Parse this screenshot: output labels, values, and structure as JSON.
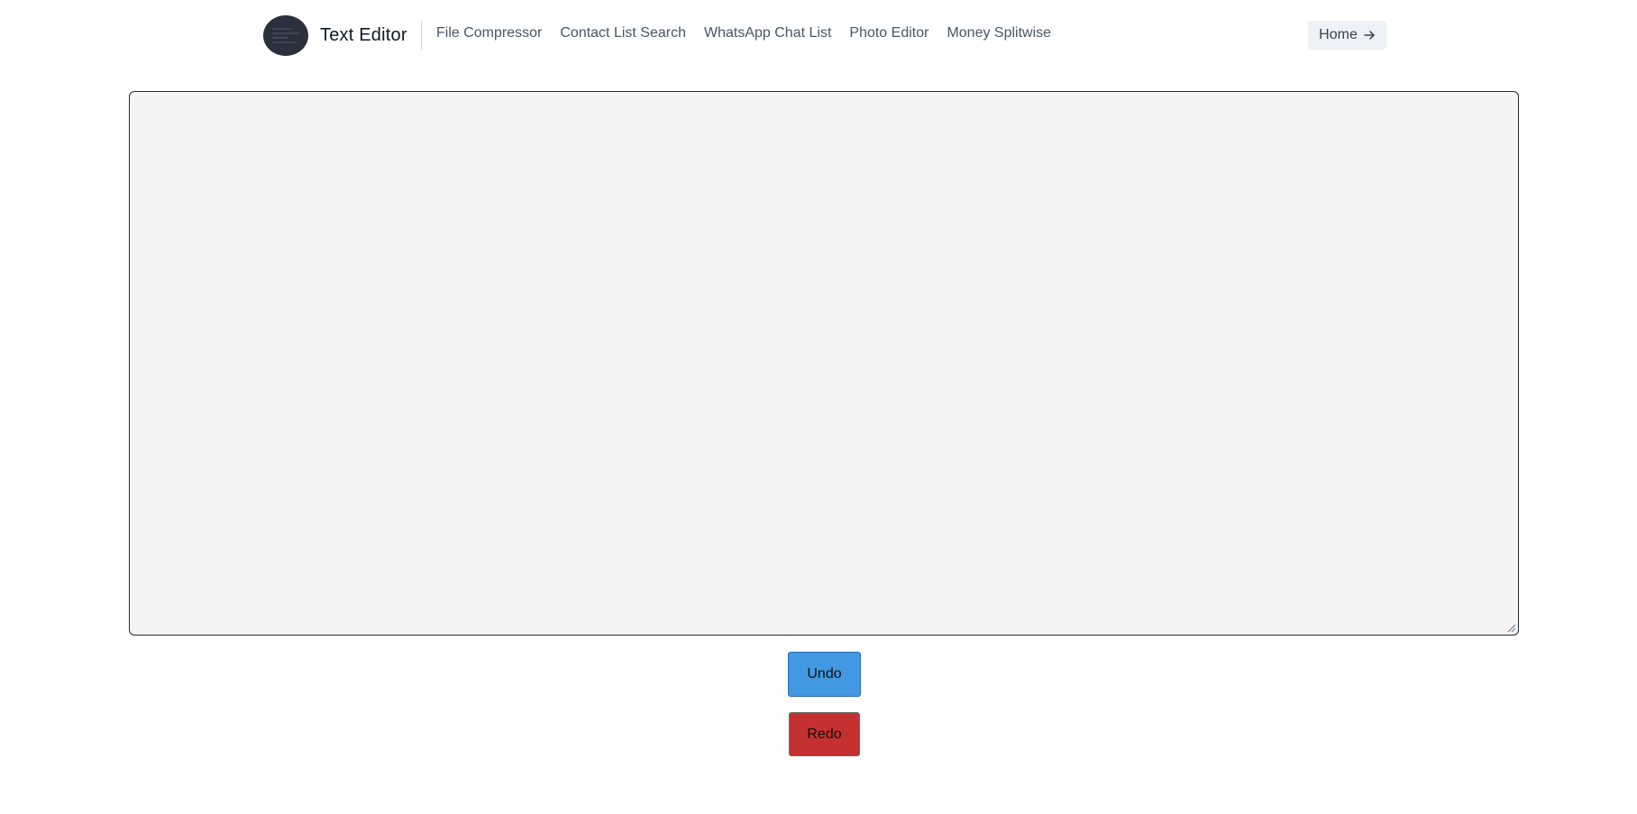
{
  "navbar": {
    "brand_title": "Text Editor",
    "links": [
      {
        "label": "File Compressor"
      },
      {
        "label": "Contact List Search"
      },
      {
        "label": "WhatsApp Chat List"
      },
      {
        "label": "Photo Editor"
      },
      {
        "label": "Money Splitwise"
      }
    ],
    "home_label": "Home",
    "home_icon": "arrow-right-icon"
  },
  "editor": {
    "value": "",
    "background": "#f4f4f4"
  },
  "actions": {
    "undo_label": "Undo",
    "redo_label": "Redo",
    "undo_color": "#4299e1",
    "redo_color": "#c53030"
  }
}
